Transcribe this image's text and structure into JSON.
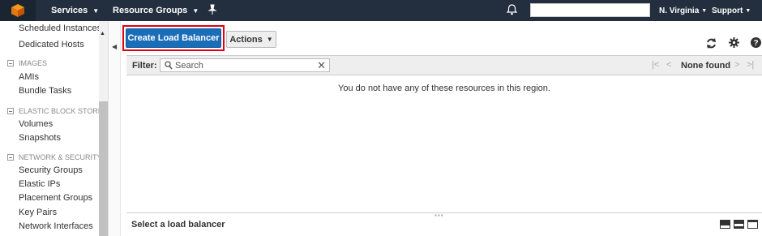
{
  "topbar": {
    "services": "Services",
    "resource_groups": "Resource Groups",
    "region": "N. Virginia",
    "support": "Support"
  },
  "sidebar": {
    "items_top": [
      "Scheduled Instances",
      "Dedicated Hosts"
    ],
    "images_title": "IMAGES",
    "images": [
      "AMIs",
      "Bundle Tasks"
    ],
    "ebs_title": "ELASTIC BLOCK STORE",
    "ebs": [
      "Volumes",
      "Snapshots"
    ],
    "netsec_title": "NETWORK & SECURITY",
    "netsec": [
      "Security Groups",
      "Elastic IPs",
      "Placement Groups",
      "Key Pairs",
      "Network Interfaces"
    ]
  },
  "toolbar": {
    "create_label": "Create Load Balancer",
    "actions_label": "Actions"
  },
  "filter": {
    "label": "Filter:",
    "placeholder": "Search",
    "pager_status": "None found"
  },
  "main": {
    "empty_message": "You do not have any of these resources in this region."
  },
  "bottom": {
    "title": "Select a load balancer"
  },
  "colors": {
    "topbar_bg": "#232f3e",
    "primary_button": "#1a6eb8",
    "highlight_border": "#e2000f",
    "logo_orange": "#f7981d"
  },
  "icons": [
    "aws-cube-icon",
    "pin-icon",
    "bell-icon",
    "search-icon",
    "clear-icon",
    "refresh-icon",
    "gear-icon",
    "help-icon"
  ]
}
